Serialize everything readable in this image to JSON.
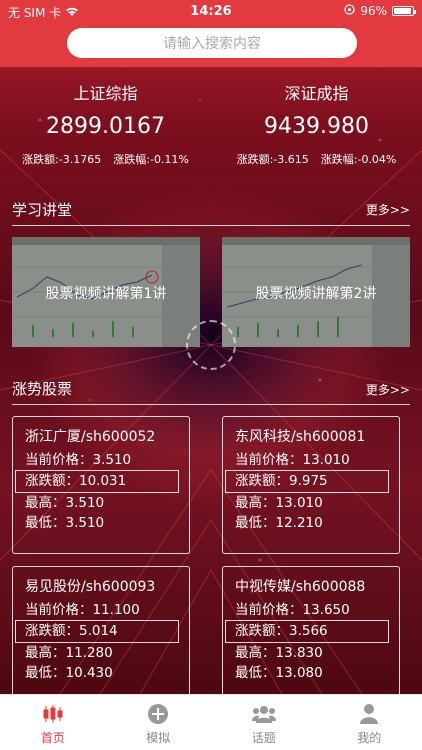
{
  "status_bar": {
    "carrier": "无 SIM 卡",
    "time": "14:26",
    "battery": "96%",
    "battery_level": 0.96
  },
  "search": {
    "placeholder": "请输入搜索内容"
  },
  "indices": [
    {
      "name": "上证综指",
      "value": "2899.0167",
      "change_amount": "涨跌额:-3.1765",
      "change_pct": "涨跌幅:-0.11%"
    },
    {
      "name": "深证成指",
      "value": "9439.980",
      "change_amount": "涨跌额:-3.615",
      "change_pct": "涨跌幅:-0.04%"
    }
  ],
  "learning": {
    "title": "学习讲堂",
    "more": "更多>>",
    "videos": [
      {
        "caption": "股票视频讲解第1讲"
      },
      {
        "caption": "股票视频讲解第2讲"
      }
    ]
  },
  "rising": {
    "title": "涨势股票",
    "more": "更多>>",
    "stocks": [
      {
        "name": "浙江广厦/sh600052",
        "price": "当前价格：3.510",
        "change": "涨跌额：10.031",
        "high": "最高：3.510",
        "low": "最低：3.510"
      },
      {
        "name": "东风科技/sh600081",
        "price": "当前价格：13.010",
        "change": "涨跌额：9.975",
        "high": "最高：13.010",
        "low": "最低：12.210"
      },
      {
        "name": "易见股份/sh600093",
        "price": "当前价格：11.100",
        "change": "涨跌额：5.014",
        "high": "最高：11.280",
        "low": "最低：10.430"
      },
      {
        "name": "中视传媒/sh600088",
        "price": "当前价格：13.650",
        "change": "涨跌额：3.566",
        "high": "最高：13.830",
        "low": "最低：13.080"
      }
    ]
  },
  "tabbar": {
    "tabs": [
      {
        "label": "首页",
        "icon": "candlestick-icon"
      },
      {
        "label": "模拟",
        "icon": "plus-circle-icon"
      },
      {
        "label": "话题",
        "icon": "group-icon"
      },
      {
        "label": "我的",
        "icon": "person-icon"
      }
    ]
  },
  "colors": {
    "accent": "#e23a3f",
    "tab_inactive": "#888888"
  }
}
